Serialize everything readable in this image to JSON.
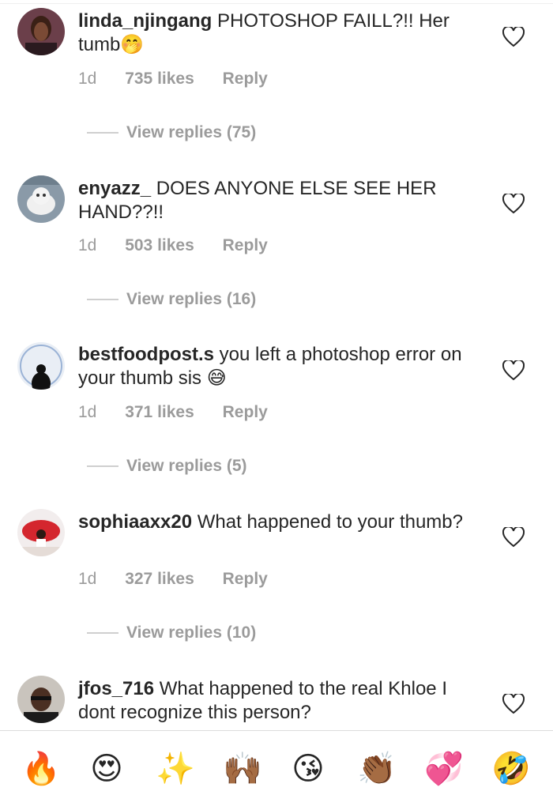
{
  "comments": [
    {
      "username": "linda_njingang",
      "text": "PHOTOSHOP FAILL?!! Her tumb",
      "emoji": "🤭",
      "time": "1d",
      "likes": "735 likes",
      "reply": "Reply",
      "view_replies": "View replies (75)"
    },
    {
      "username": "enyazz_",
      "text": "DOES ANYONE ELSE SEE HER HAND??!!",
      "emoji": "",
      "time": "1d",
      "likes": "503 likes",
      "reply": "Reply",
      "view_replies": "View replies (16)"
    },
    {
      "username": "bestfoodpost.s",
      "text": "you left a photoshop error on your thumb sis",
      "emoji": "😅",
      "time": "1d",
      "likes": "371 likes",
      "reply": "Reply",
      "view_replies": "View replies (5)"
    },
    {
      "username": "sophiaaxx20",
      "text": "What happened to your thumb?",
      "emoji": "",
      "time": "1d",
      "likes": "327 likes",
      "reply": "Reply",
      "view_replies": "View replies (10)"
    },
    {
      "username": "jfos_716",
      "text": "What happened to the real Khloe I dont recognize this person?",
      "emoji": ""
    }
  ],
  "emoji_bar": [
    "🔥",
    "😍",
    "✨",
    "🙌🏾",
    "😘",
    "👏🏾",
    "💞",
    "🤣"
  ],
  "colors": {
    "text": "#262626",
    "meta": "#9b9b9b",
    "heart": "#262626"
  }
}
